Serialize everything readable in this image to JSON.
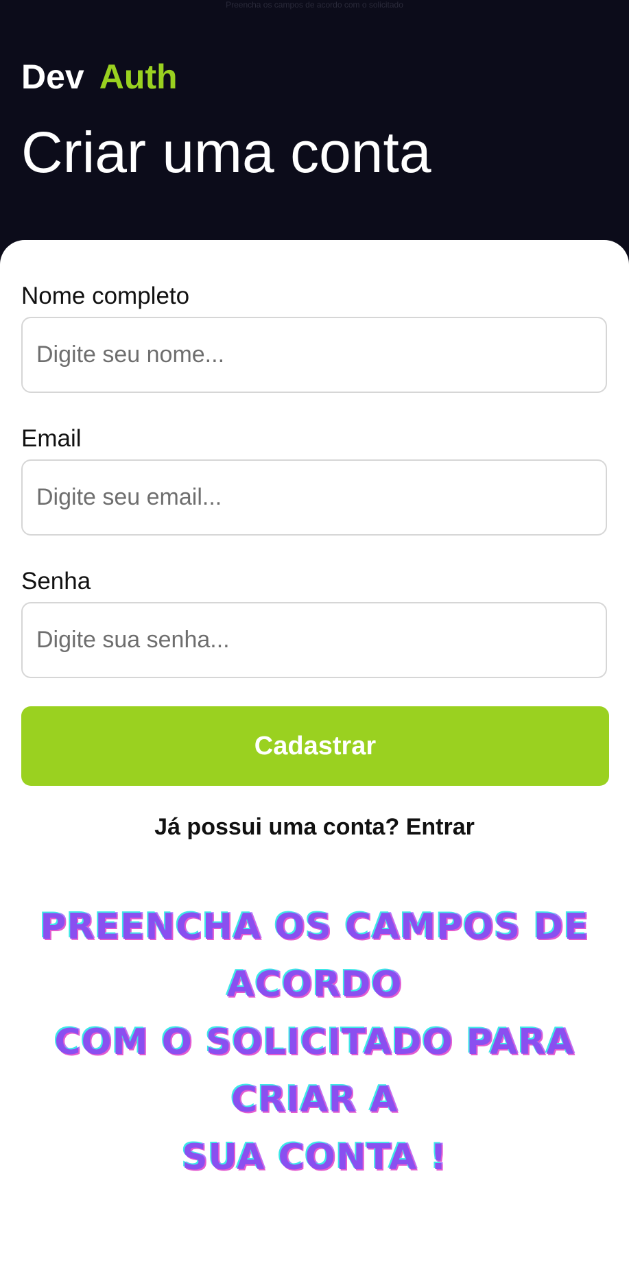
{
  "header": {
    "note": "Preencha os campos de acordo com o solicitado",
    "brand_primary": "Dev",
    "brand_accent": "Auth",
    "title": "Criar uma conta"
  },
  "form": {
    "name_label": "Nome completo",
    "name_placeholder": "Digite seu nome...",
    "email_label": "Email",
    "email_placeholder": "Digite seu email...",
    "password_label": "Senha",
    "password_placeholder": "Digite sua senha...",
    "submit_label": "Cadastrar"
  },
  "footer": {
    "question": "Já possui uma conta?",
    "action": "Entrar"
  },
  "banner": {
    "lines": [
      "Preencha os campos de acordo",
      "com o solicitado para criar a",
      "sua conta !"
    ]
  },
  "colors": {
    "background": "#0c0c1a",
    "accent": "#9ad120",
    "banner": "#8a4ff0"
  }
}
